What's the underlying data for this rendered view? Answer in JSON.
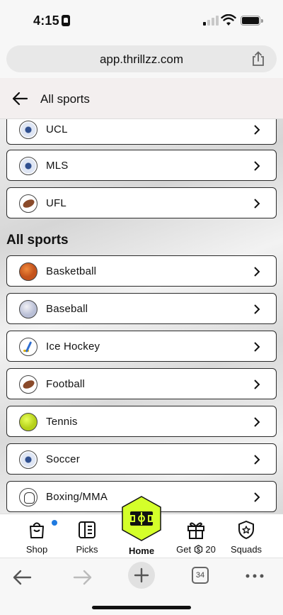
{
  "status": {
    "time": "4:15"
  },
  "browser": {
    "url": "app.thrillzz.com",
    "tab_count": "34"
  },
  "header": {
    "title": "All sports"
  },
  "featured_items": [
    {
      "label": "UCL",
      "icon": "soccer-ball-icon"
    },
    {
      "label": "MLS",
      "icon": "soccer-ball-icon"
    },
    {
      "label": "UFL",
      "icon": "football-icon"
    }
  ],
  "section": {
    "title": "All sports"
  },
  "sports": [
    {
      "label": "Basketball",
      "icon": "basketball-icon"
    },
    {
      "label": "Baseball",
      "icon": "baseball-icon"
    },
    {
      "label": "Ice Hockey",
      "icon": "hockey-stick-icon"
    },
    {
      "label": "Football",
      "icon": "football-icon"
    },
    {
      "label": "Tennis",
      "icon": "tennis-ball-icon"
    },
    {
      "label": "Soccer",
      "icon": "soccer-ball-icon"
    },
    {
      "label": "Boxing/MMA",
      "icon": "boxing-glove-icon"
    }
  ],
  "tabbar": {
    "shop": "Shop",
    "picks": "Picks",
    "home": "Home",
    "get": "Get",
    "get_amount": "20",
    "squads": "Squads"
  },
  "colors": {
    "accent": "#d4ff2a",
    "notification_dot": "#1f7ae0",
    "row_border": "#2a2a2a"
  }
}
